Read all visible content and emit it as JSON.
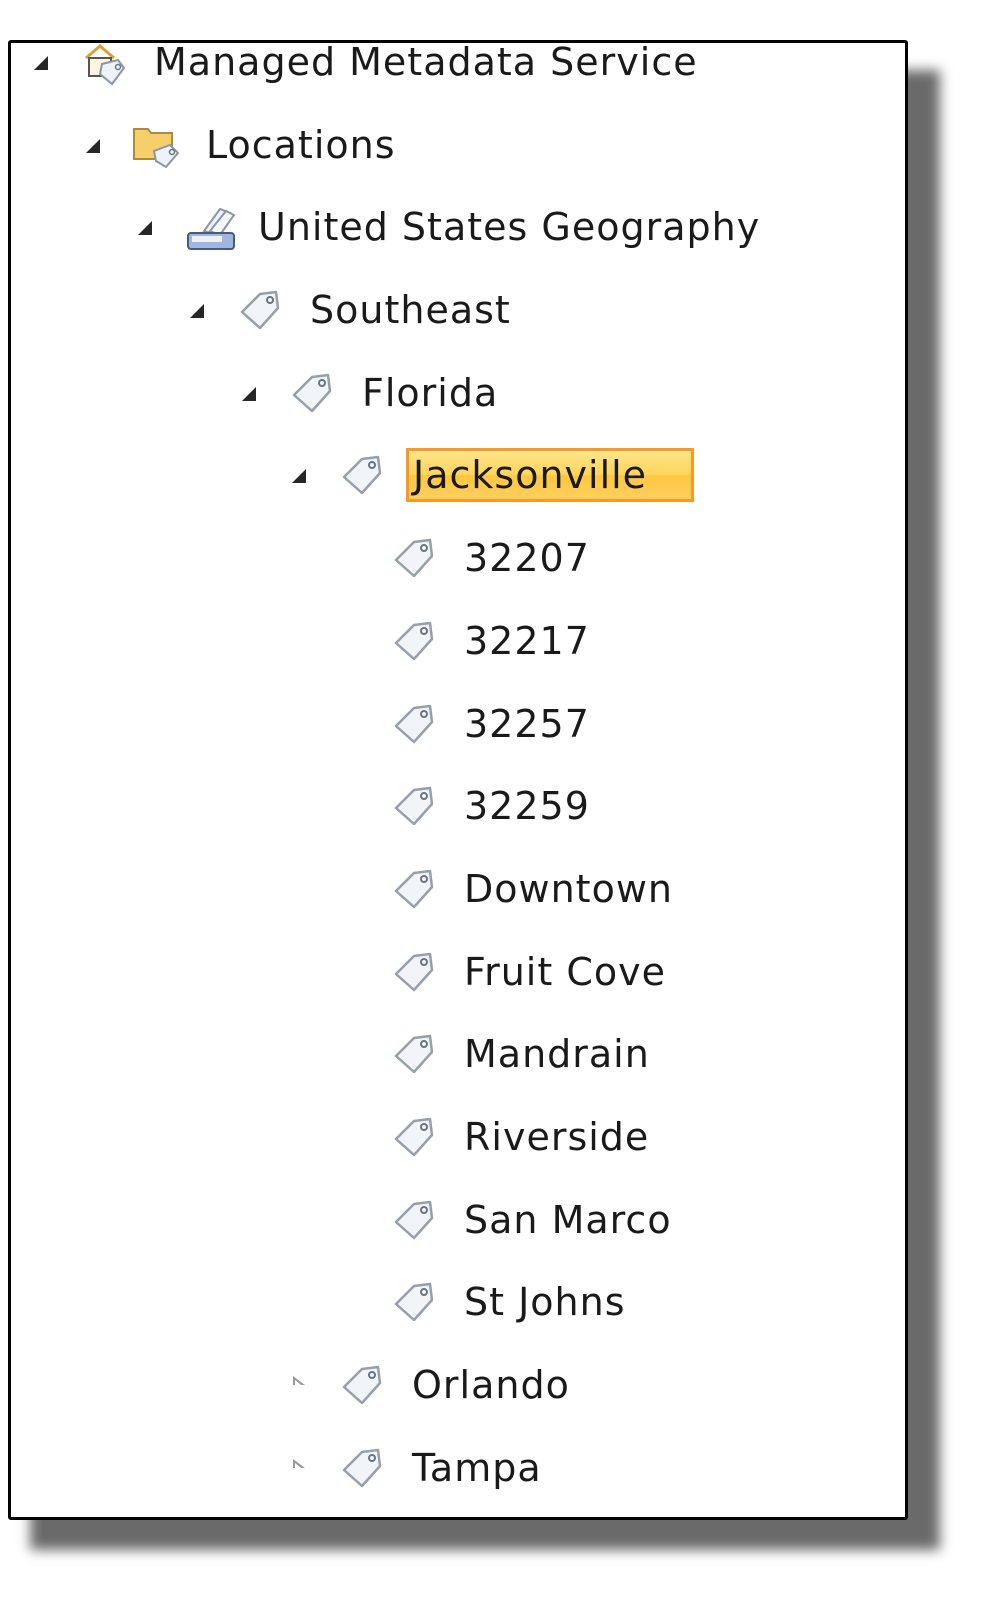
{
  "tree": {
    "root": {
      "label": "Managed Metadata Service",
      "icon": "managed-metadata-service-icon",
      "state": "expanded"
    },
    "group": {
      "label": "Locations",
      "icon": "term-group-folder-icon",
      "state": "expanded"
    },
    "termset": {
      "label": "United States Geography",
      "icon": "term-set-icon",
      "state": "expanded"
    },
    "terms": [
      {
        "label": "Southeast",
        "icon": "tag-icon",
        "state": "expanded",
        "level": 3
      },
      {
        "label": "Florida",
        "icon": "tag-icon",
        "state": "expanded",
        "level": 4
      },
      {
        "label": "Jacksonville",
        "icon": "tag-icon",
        "state": "expanded",
        "level": 5,
        "selected": true
      },
      {
        "label": "32207",
        "icon": "tag-icon",
        "state": "leaf",
        "level": 6
      },
      {
        "label": "32217",
        "icon": "tag-icon",
        "state": "leaf",
        "level": 6
      },
      {
        "label": "32257",
        "icon": "tag-icon",
        "state": "leaf",
        "level": 6
      },
      {
        "label": "32259",
        "icon": "tag-icon",
        "state": "leaf",
        "level": 6
      },
      {
        "label": "Downtown",
        "icon": "tag-icon",
        "state": "leaf",
        "level": 6
      },
      {
        "label": "Fruit Cove",
        "icon": "tag-icon",
        "state": "leaf",
        "level": 6
      },
      {
        "label": "Mandrain",
        "icon": "tag-icon",
        "state": "leaf",
        "level": 6
      },
      {
        "label": "Riverside",
        "icon": "tag-icon",
        "state": "leaf",
        "level": 6
      },
      {
        "label": "San Marco",
        "icon": "tag-icon",
        "state": "leaf",
        "level": 6
      },
      {
        "label": "St Johns",
        "icon": "tag-icon",
        "state": "leaf",
        "level": 6
      },
      {
        "label": "Orlando",
        "icon": "tag-icon",
        "state": "collapsed",
        "level": 5
      },
      {
        "label": "Tampa",
        "icon": "tag-icon",
        "state": "collapsed",
        "level": 5
      }
    ]
  },
  "colors": {
    "selection_fill": "#ffd45a",
    "selection_border": "#f59a2a",
    "text": "#1a1a1a"
  }
}
